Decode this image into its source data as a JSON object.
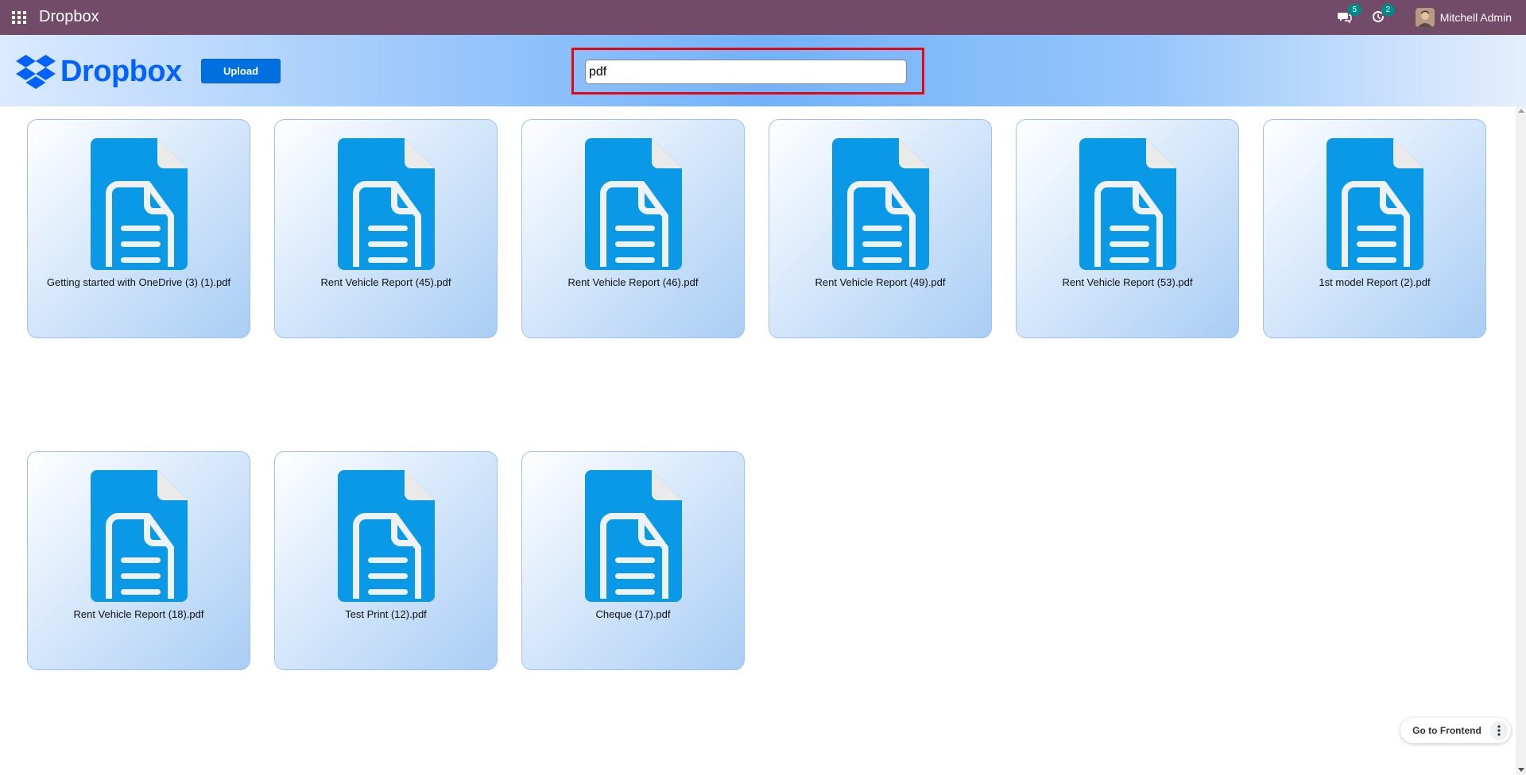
{
  "navbar": {
    "title": "Dropbox",
    "apps_icon": "grid-apps-icon",
    "messages_badge": "5",
    "activity_badge": "2",
    "user_name": "Mitchell Admin",
    "bg_color": "#714b67",
    "badge_color": "#018b88"
  },
  "header": {
    "logo_text": "Dropbox",
    "logo_icon": "dropbox-box-icon",
    "brand_color": "#0061fe",
    "upload_label": "Upload",
    "search_value": "pdf",
    "highlight_color": "#e30613"
  },
  "files": [
    {
      "name": "Getting started with OneDrive (3) (1).pdf",
      "icon": "document-icon"
    },
    {
      "name": "Rent Vehicle Report (45).pdf",
      "icon": "document-icon"
    },
    {
      "name": "Rent Vehicle Report (46).pdf",
      "icon": "document-icon"
    },
    {
      "name": "Rent Vehicle Report (49).pdf",
      "icon": "document-icon"
    },
    {
      "name": "Rent Vehicle Report (53).pdf",
      "icon": "document-icon"
    },
    {
      "name": "1st model Report (2).pdf",
      "icon": "document-icon"
    },
    {
      "name": "Rent Vehicle Report (18).pdf",
      "icon": "document-icon"
    },
    {
      "name": "Test Print (12).pdf",
      "icon": "document-icon"
    },
    {
      "name": "Cheque (17).pdf",
      "icon": "document-icon"
    }
  ],
  "footer": {
    "frontend_label": "Go to Frontend"
  }
}
